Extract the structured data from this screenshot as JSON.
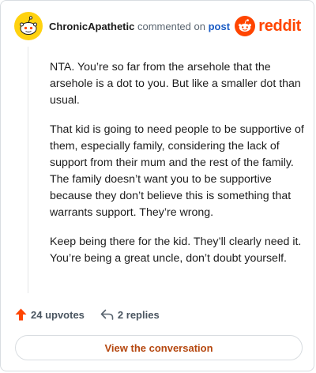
{
  "comment": {
    "author": "ChronicApathetic",
    "action_text": "commented on",
    "post_link": "post",
    "paragraphs": [
      "NTA. You’re so far from the arsehole that the arsehole is a dot to you. But like a smaller dot than usual.",
      "That kid is going to need people to be supportive of them, especially family, considering the lack of support from their mum and the rest of the family. The family doesn’t want you to be supportive because they don’t believe this is something that warrants support. They’re wrong.",
      "Keep being there for the kid. They’ll clearly need it. You’re being a great uncle, don’t doubt yourself."
    ],
    "upvotes_label": "24 upvotes",
    "replies_label": "2 replies"
  },
  "brand": {
    "name": "reddit",
    "color": "#ff4500"
  },
  "cta": {
    "label": "View the conversation"
  },
  "colors": {
    "avatar": "#ffd20f",
    "upvote": "#ff4500",
    "link": "#1a5bc4",
    "cta_text": "#b5470f"
  },
  "icons": {
    "avatar": "snoo-avatar-icon",
    "brand": "reddit-snoo-icon",
    "upvote": "upvote-arrow-icon",
    "reply": "reply-arrow-icon"
  }
}
